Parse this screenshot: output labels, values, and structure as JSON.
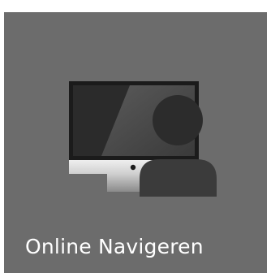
{
  "tile": {
    "label": "Online Navigeren",
    "icon": "monitor-with-person-icon",
    "background_color": "#6c6c6c",
    "label_color": "#ffffff"
  }
}
